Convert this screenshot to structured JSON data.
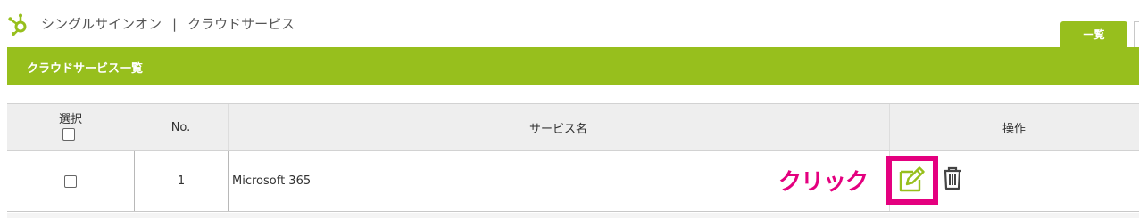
{
  "header": {
    "logo_icon": "hubspot-sprocket-icon",
    "breadcrumb": [
      "シングルサインオン",
      "|",
      "クラウドサービス"
    ]
  },
  "tabs": [
    {
      "label": "一覧",
      "active": true
    }
  ],
  "banner": {
    "title": "クラウドサービス一覧"
  },
  "table": {
    "columns": {
      "select": "選択",
      "no": "No.",
      "name": "サービス名",
      "ops": "操作"
    },
    "rows": [
      {
        "selected": false,
        "no": "1",
        "name": "Microsoft 365",
        "actions": [
          "edit-icon",
          "trash-icon"
        ]
      }
    ]
  },
  "annotation": {
    "text": "クリック",
    "color": "#e4007f"
  },
  "colors": {
    "accent": "#97bf1d",
    "highlight": "#e4007f",
    "header_bg": "#eeeeee"
  }
}
